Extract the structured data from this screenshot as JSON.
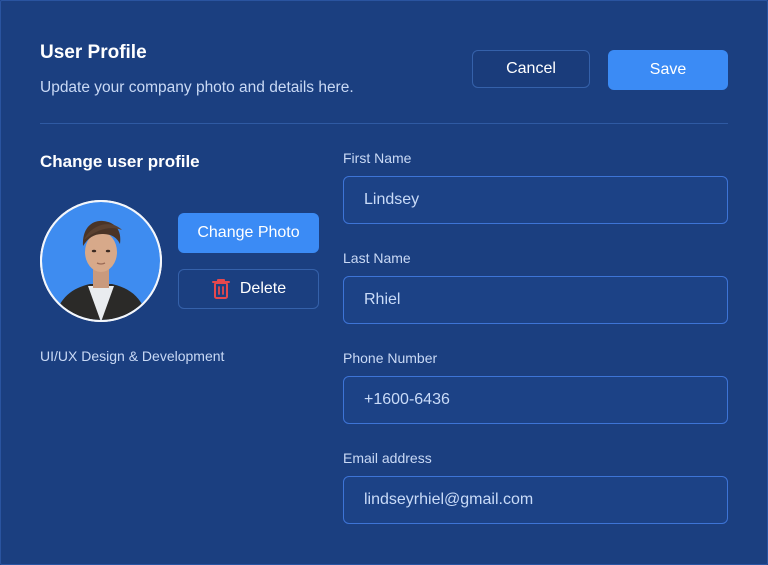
{
  "header": {
    "title": "User Profile",
    "subtitle": "Update your company photo and details here.",
    "cancel_label": "Cancel",
    "save_label": "Save"
  },
  "profile": {
    "section_title": "Change user profile",
    "change_photo_label": "Change Photo",
    "delete_label": "Delete",
    "role": "UI/UX Design & Development",
    "avatar_icon": "avatar-photo"
  },
  "form": {
    "fields": [
      {
        "label": "First Name",
        "value": "Lindsey"
      },
      {
        "label": "Last Name",
        "value": "Rhiel"
      },
      {
        "label": "Phone Number",
        "value": "+1600-6436"
      },
      {
        "label": "Email address",
        "value": "lindseyrhiel@gmail.com"
      }
    ]
  },
  "colors": {
    "background": "#1b3f80",
    "accent": "#3b8bf5",
    "field_border": "#3d74d6",
    "delete_icon": "#e5484d"
  }
}
